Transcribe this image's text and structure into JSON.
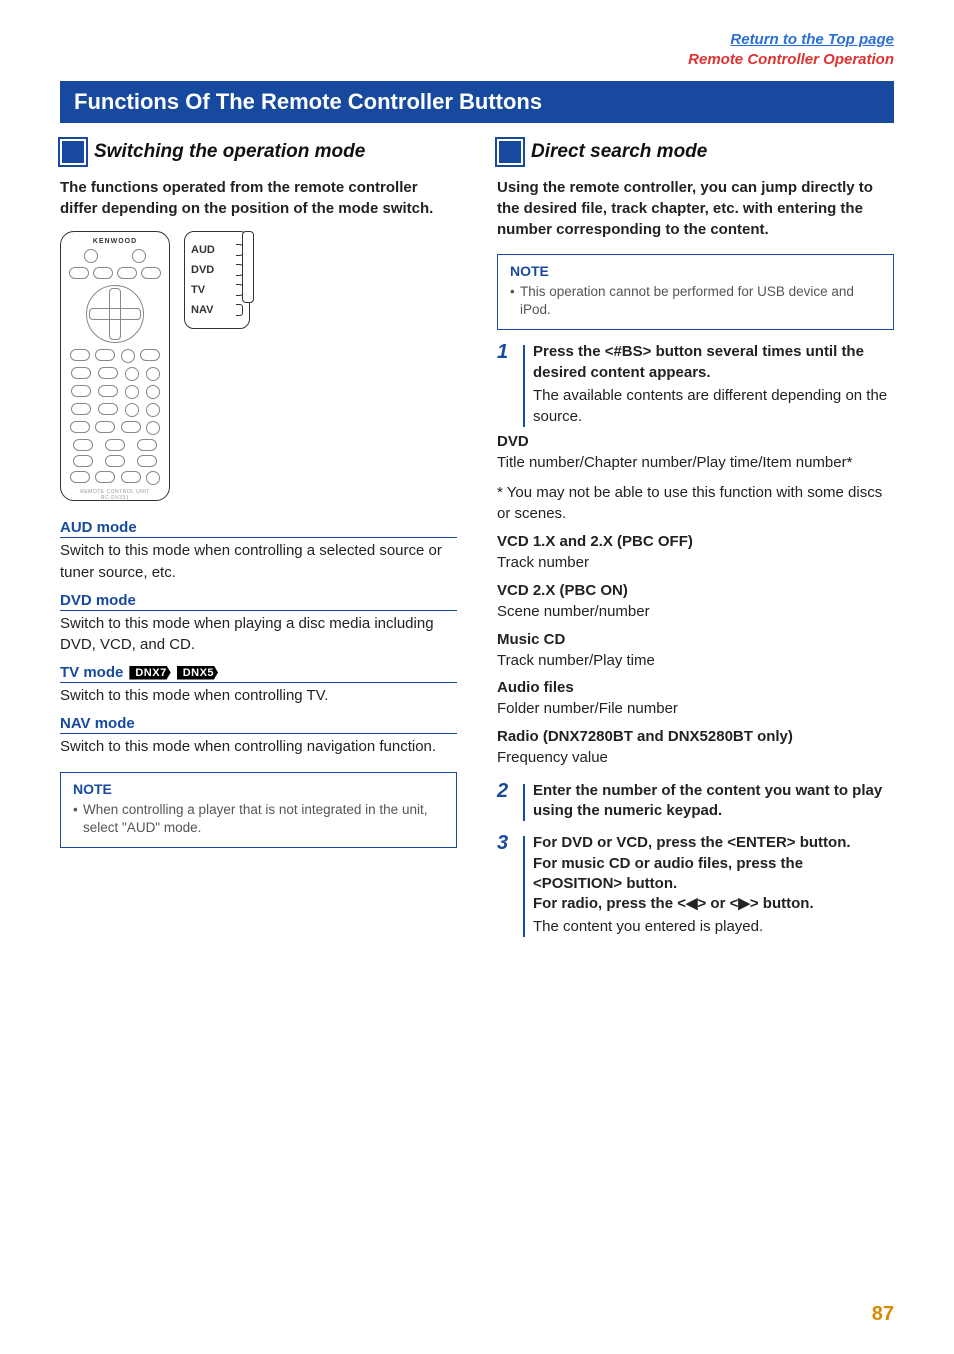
{
  "header": {
    "link_top": "Return to the Top page",
    "link_section": "Remote Controller Operation"
  },
  "title": "Functions Of The Remote Controller Buttons",
  "left": {
    "section_title": "Switching the operation mode",
    "lead": "The functions operated from the remote controller differ depending on the position of the mode switch.",
    "remote": {
      "brand": "KENWOOD",
      "model": "RC-DV331"
    },
    "switch": {
      "pos1": "AUD",
      "pos2": "DVD",
      "pos3": "TV",
      "pos4": "NAV"
    },
    "modes": [
      {
        "title": "AUD mode",
        "desc": "Switch to this mode when controlling a selected source or tuner source, etc.",
        "badges": []
      },
      {
        "title": "DVD mode",
        "desc": "Switch to this mode when playing a disc media including DVD, VCD, and CD.",
        "badges": []
      },
      {
        "title": "TV mode",
        "desc": "Switch to this mode when controlling TV.",
        "badges": [
          "DNX7",
          "DNX5"
        ]
      },
      {
        "title": "NAV mode",
        "desc": "Switch to this mode when controlling navigation function.",
        "badges": []
      }
    ],
    "note_title": "NOTE",
    "note_item": "When controlling a player that is not integrated in the unit, select \"AUD\" mode."
  },
  "right": {
    "section_title": "Direct search mode",
    "lead": "Using the remote controller, you can jump directly to the desired file, track chapter, etc. with entering the number corresponding to the content.",
    "note_title": "NOTE",
    "note_item": "This operation cannot be performed for USB device and iPod.",
    "step1_num": "1",
    "step1_cmd": "Press the <#BS> button several times until the desired content appears.",
    "step1_desc": "The available contents are different depending on the source.",
    "lists": [
      {
        "h": "DVD",
        "v": "Title number/Chapter number/Play time/Item number*"
      },
      {
        "h": "",
        "v": "* You may not be able to use this function with some discs or scenes."
      },
      {
        "h": "VCD 1.X and 2.X (PBC OFF)",
        "v": "Track number"
      },
      {
        "h": "VCD 2.X (PBC ON)",
        "v": "Scene number/number"
      },
      {
        "h": "Music CD",
        "v": "Track number/Play time"
      },
      {
        "h": "Audio files",
        "v": "Folder number/File number"
      },
      {
        "h": "Radio (DNX7280BT and DNX5280BT only)",
        "v": "Frequency value"
      }
    ],
    "step2_num": "2",
    "step2_cmd": "Enter the number of the content you want to play using the numeric keypad.",
    "step3_num": "3",
    "step3_cmd_l1": "For DVD or VCD, press the <ENTER> button.",
    "step3_cmd_l2": "For music CD or audio files, press the <POSITION> button.",
    "step3_cmd_l3": "For radio, press the <◀> or <▶> button.",
    "step3_desc": "The content you entered is played."
  },
  "page_number": "87"
}
